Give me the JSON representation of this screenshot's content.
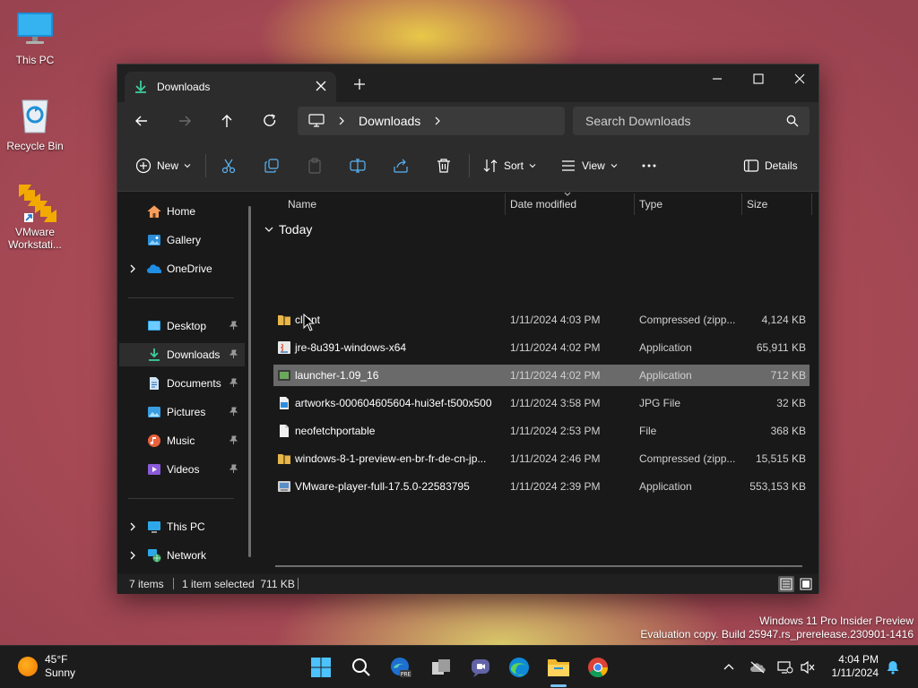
{
  "desktop": {
    "icons": [
      {
        "label": "This PC"
      },
      {
        "label": "Recycle Bin"
      },
      {
        "label": "VMware Workstati..."
      }
    ]
  },
  "window": {
    "tab_title": "Downloads",
    "breadcrumb": [
      "Downloads"
    ],
    "search_placeholder": "Search Downloads",
    "toolbar": {
      "new_label": "New",
      "sort_label": "Sort",
      "view_label": "View",
      "details_label": "Details"
    },
    "nav": {
      "items": [
        {
          "label": "Home",
          "icon": "home-icon"
        },
        {
          "label": "Gallery",
          "icon": "gallery-icon"
        },
        {
          "label": "OneDrive",
          "icon": "onedrive-icon"
        },
        {
          "label": "Desktop",
          "icon": "desktop-folder-icon"
        },
        {
          "label": "Downloads",
          "icon": "downloads-folder-icon"
        },
        {
          "label": "Documents",
          "icon": "documents-folder-icon"
        },
        {
          "label": "Pictures",
          "icon": "pictures-folder-icon"
        },
        {
          "label": "Music",
          "icon": "music-folder-icon"
        },
        {
          "label": "Videos",
          "icon": "videos-folder-icon"
        },
        {
          "label": "This PC",
          "icon": "this-pc-icon"
        },
        {
          "label": "Network",
          "icon": "network-icon"
        }
      ]
    },
    "columns": {
      "name": "Name",
      "date": "Date modified",
      "type": "Type",
      "size": "Size"
    },
    "group_label": "Today",
    "files": [
      {
        "name": "client",
        "date": "1/11/2024 4:03 PM",
        "type": "Compressed (zipp...",
        "size": "4,124 KB",
        "icon": "zip-folder-icon"
      },
      {
        "name": "jre-8u391-windows-x64",
        "date": "1/11/2024 4:02 PM",
        "type": "Application",
        "size": "65,911 KB",
        "icon": "java-installer-icon"
      },
      {
        "name": "launcher-1.09_16",
        "date": "1/11/2024 4:02 PM",
        "type": "Application",
        "size": "712 KB",
        "icon": "app-icon"
      },
      {
        "name": "artworks-000604605604-hui3ef-t500x500",
        "date": "1/11/2024 3:58 PM",
        "type": "JPG File",
        "size": "32 KB",
        "icon": "image-file-icon"
      },
      {
        "name": "neofetchportable",
        "date": "1/11/2024 2:53 PM",
        "type": "File",
        "size": "368 KB",
        "icon": "file-icon"
      },
      {
        "name": "windows-8-1-preview-en-br-fr-de-cn-jp...",
        "date": "1/11/2024 2:46 PM",
        "type": "Compressed (zipp...",
        "size": "15,515 KB",
        "icon": "zip-folder-icon"
      },
      {
        "name": "VMware-player-full-17.5.0-22583795",
        "date": "1/11/2024 2:39 PM",
        "type": "Application",
        "size": "553,153 KB",
        "icon": "installer-icon"
      }
    ],
    "status": {
      "count": "7 items",
      "selection": "1 item selected  711 KB"
    }
  },
  "watermark": {
    "line1": "Windows 11 Pro Insider Preview",
    "line2": "Evaluation copy. Build 25947.rs_prerelease.230901-1416"
  },
  "taskbar": {
    "weather_temp": "45°F",
    "weather_cond": "Sunny",
    "time": "4:04 PM",
    "date": "1/11/2024"
  }
}
